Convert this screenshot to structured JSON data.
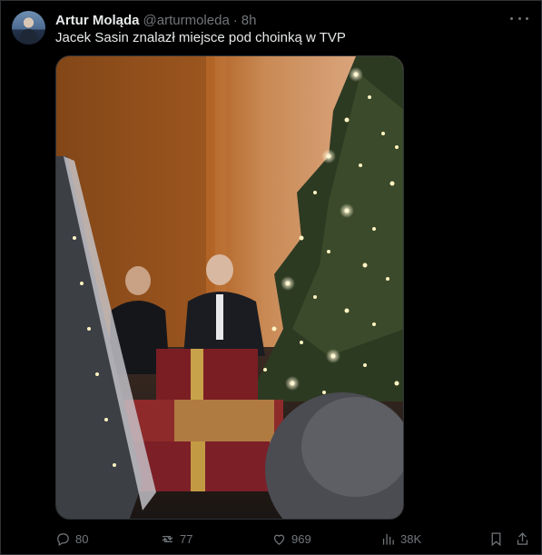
{
  "tweet": {
    "author_name": "Artur Moląda",
    "handle": "@arturmoleda",
    "separator": "·",
    "time": "8h",
    "text": "Jacek Sasin znalazł miejsce pod choinką w TVP"
  },
  "actions": {
    "replies": "80",
    "reposts": "77",
    "likes": "969",
    "views": "38K"
  },
  "icons": {
    "more": "more-horizontal-icon",
    "reply": "reply-icon",
    "repost": "repost-icon",
    "like": "heart-icon",
    "views": "bar-chart-icon",
    "bookmark": "bookmark-icon",
    "share": "share-icon"
  },
  "colors": {
    "background": "#000000",
    "text": "#e7e9ea",
    "muted": "#71767b",
    "border": "#2f3336"
  }
}
